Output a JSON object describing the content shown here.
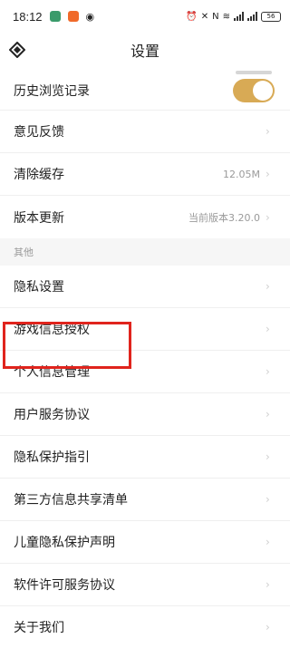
{
  "status": {
    "time": "18:12",
    "battery": "56"
  },
  "header": {
    "title": "设置"
  },
  "settings": {
    "history": "历史浏览记录",
    "feedback": "意见反馈",
    "clear_cache": "清除缓存",
    "cache_size": "12.05M",
    "update": "版本更新",
    "version": "当前版本3.20.0"
  },
  "other": {
    "section_title": "其他",
    "items": [
      "隐私设置",
      "游戏信息授权",
      "个人信息管理",
      "用户服务协议",
      "隐私保护指引",
      "第三方信息共享清单",
      "儿童隐私保护声明",
      "软件许可服务协议",
      "关于我们"
    ]
  },
  "colors": {
    "toggle_on": "#d8aa55",
    "highlight_box": "#e0241d"
  }
}
